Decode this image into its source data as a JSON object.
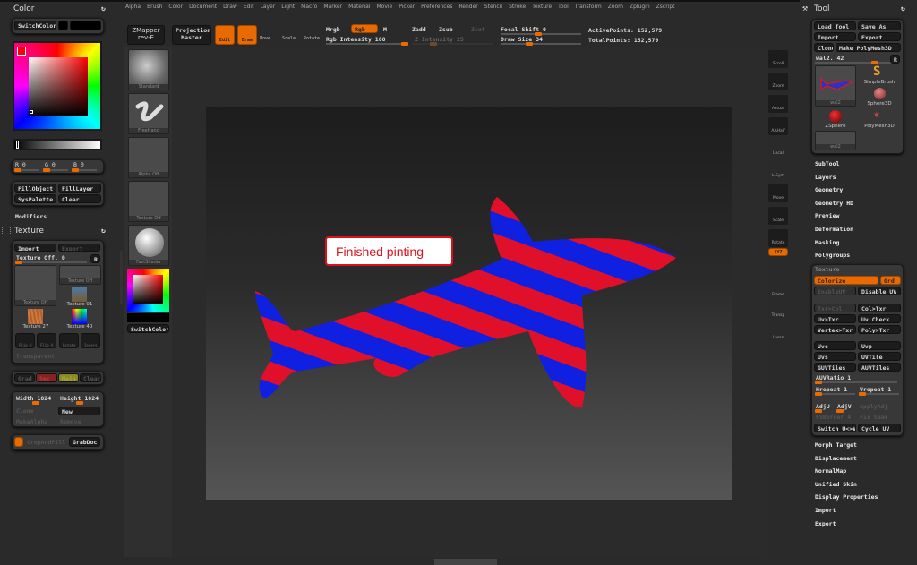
{
  "menu": [
    "Alpha",
    "Brush",
    "Color",
    "Document",
    "Draw",
    "Edit",
    "Layer",
    "Light",
    "Macro",
    "Marker",
    "Material",
    "Movie",
    "Picker",
    "Preferences",
    "Render",
    "Stencil",
    "Stroke",
    "Texture",
    "Tool",
    "Transform",
    "Zoom",
    "Zplugin",
    "Zscript"
  ],
  "toolbar": {
    "zmapper": "ZMapper",
    "zmapper_sub": "rev-E",
    "projection": "Projection",
    "projection_sub": "Master",
    "edit": "Edit",
    "draw": "Draw",
    "move": "Move",
    "scale": "Scale",
    "rotate": "Rotate",
    "mrgb": "Mrgb",
    "rgb": "Rgb",
    "m": "M",
    "rgb_intensity": "Rgb Intensity 100",
    "zadd": "Zadd",
    "zsub": "Zsub",
    "zcut": "Zcut",
    "z_intensity": "Z Intensity 25",
    "focal_shift": "Focal Shift 0",
    "draw_size": "Draw Size 34",
    "active_points": "ActivePoints: 152,579",
    "total_points": "TotalPoints: 152,579",
    "rgb_intensity_value": 100,
    "z_intensity_value": 25,
    "focal_shift_value": 0,
    "draw_size_value": 34
  },
  "color_panel": {
    "title": "Color",
    "switch_color": "SwitchColor",
    "r": "R 0",
    "g": "G 0",
    "b": "B 0",
    "fill_object": "FillObject",
    "fill_layer": "FillLayer",
    "sys_palette": "SysPalette",
    "clear": "Clear",
    "modifiers": "Modifiers",
    "main_color": "#000000"
  },
  "texture_panel": {
    "title": "Texture",
    "import": "Import",
    "export": "Export",
    "texture_off": "Texture Off. 0",
    "r": "R",
    "thumbs": [
      "Texture Off",
      "Texture Off",
      "Texture 01",
      "Texture 27",
      "Texture 40"
    ],
    "flip_h": "Flip H",
    "flip_v": "Flip V",
    "rotate": "Rotate",
    "invers": "Invers",
    "transparent": "Transparent",
    "grad": "Grad",
    "sec": "Sec",
    "main": "Main",
    "clear": "Clear",
    "width": "Width 1024",
    "height": "Height 1024",
    "clone": "Clone",
    "new": "New",
    "make_alpha": "MakeAlpha",
    "remove": "Remove",
    "crop_and_fill": "CropAndFill",
    "grab_doc": "GrabDoc"
  },
  "brush_column": {
    "items": [
      "Standard",
      "FreeHand",
      "Alpha Off",
      "Texture Off",
      "FastShader"
    ],
    "switch_color": "SwitchColor"
  },
  "canvas": {
    "annotation": "Finished pinting",
    "stripe_colors": [
      "#e0102a",
      "#1020e0"
    ]
  },
  "right_shelf": [
    "Scroll",
    "Zoom",
    "Actual",
    "AAHalf",
    "Local",
    "L.Sym",
    "Move",
    "Scale",
    "Rotate",
    "XYZ",
    "Frame",
    "Transp",
    "Lasso"
  ],
  "tool_panel": {
    "title": "Tool",
    "load_tool": "Load Tool",
    "save_as": "Save As",
    "import": "Import",
    "export": "Export",
    "clone": "Clone",
    "make_polymesh": "Make PolyMesh3D",
    "current_tool": "wal2. 42",
    "r": "R",
    "tools": [
      "wal2",
      "SimpleBrush",
      "Sphere3D",
      "ZSphere",
      "PolyMesh3D",
      "wal2"
    ],
    "sections": [
      "SubTool",
      "Layers",
      "Geometry",
      "Geometry HD",
      "Preview",
      "Deformation",
      "Masking",
      "Polygroups"
    ],
    "texture": {
      "title": "Texture",
      "colorize": "Colorize",
      "grd": "Grd",
      "enable_uv": "EnableUV",
      "disable_uv": "Disable UV",
      "txr_col": "Txr>Col",
      "col_txr": "Col>Txr",
      "uv_txr": "Uv>Txr",
      "uv_check": "Uv Check",
      "vertex_txr": "Vertex>Txr",
      "poly_txr": "Poly>Txr",
      "uvc": "Uvc",
      "uvp": "Uvp",
      "uvs": "Uvs",
      "uvtile": "UVTile",
      "guvtiles": "GUVTiles",
      "auvtiles": "AUVTiles",
      "auvratio": "AUVRatio 1",
      "hrepeat": "Hrepeat 1",
      "vrepeat": "Vrepeat 1",
      "adju": "AdjU",
      "adjv": "AdjV",
      "apply_adj": "ApplyAdj",
      "fsborder": "FSBorder 4",
      "fix_seam": "Fix Seam",
      "switch_uv": "Switch U<>V",
      "cycle_uv": "Cycle UV"
    },
    "sections2": [
      "Morph Target",
      "Displacement",
      "NormalMap",
      "Unified Skin",
      "Display Properties",
      "Import",
      "Export"
    ]
  }
}
